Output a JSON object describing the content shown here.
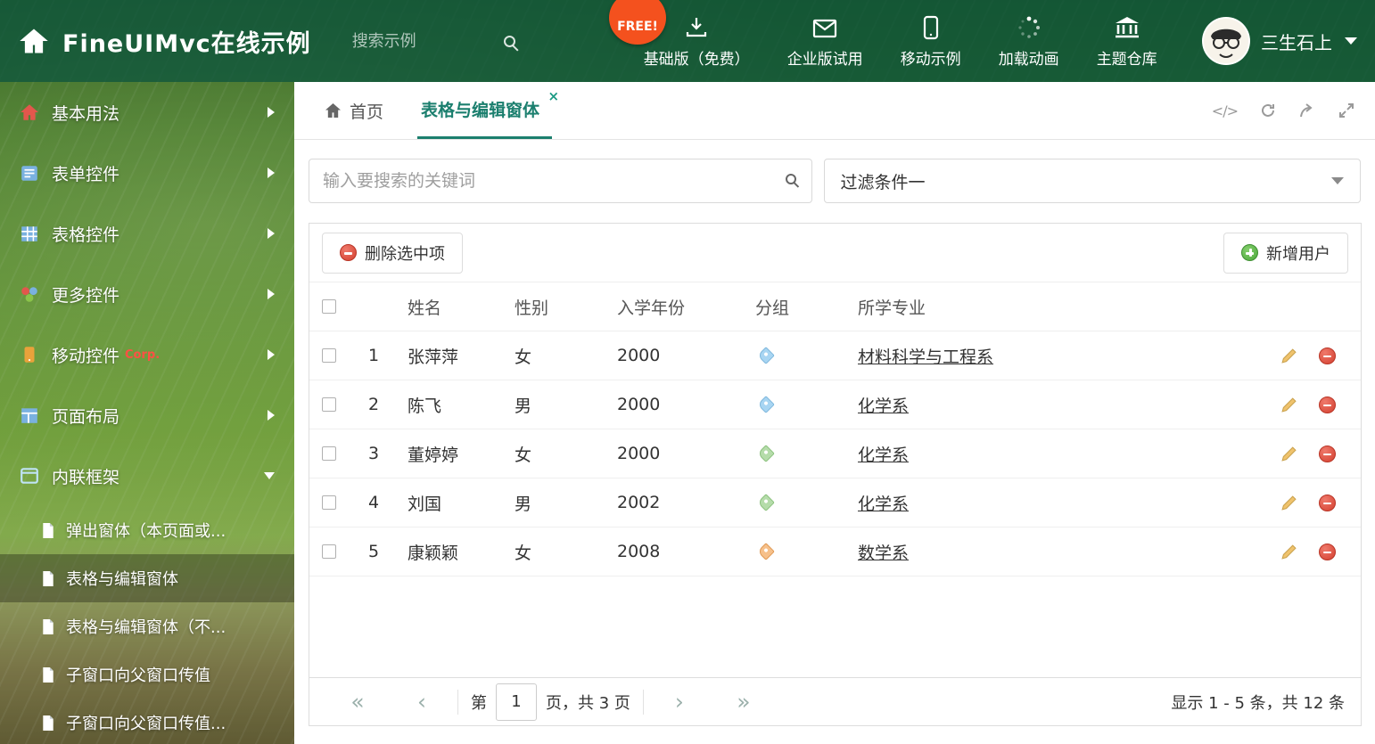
{
  "header": {
    "title": "FineUIMvc在线示例",
    "search_placeholder": "搜索示例",
    "free_badge": "FREE!",
    "nav": [
      {
        "label": "基础版（免费）",
        "icon": "download-icon"
      },
      {
        "label": "企业版试用",
        "icon": "envelope-icon"
      },
      {
        "label": "移动示例",
        "icon": "mobile-icon"
      },
      {
        "label": "加载动画",
        "icon": "spinner-icon"
      },
      {
        "label": "主题仓库",
        "icon": "bank-icon"
      }
    ],
    "user_name": "三生石上"
  },
  "sidebar": {
    "items": [
      {
        "label": "基本用法",
        "icon": "home-icon"
      },
      {
        "label": "表单控件",
        "icon": "form-icon"
      },
      {
        "label": "表格控件",
        "icon": "table-icon"
      },
      {
        "label": "更多控件",
        "icon": "widgets-icon"
      },
      {
        "label": "移动控件",
        "badge": "Corp.",
        "icon": "mobile-icon"
      },
      {
        "label": "页面布局",
        "icon": "layout-icon"
      },
      {
        "label": "内联框架",
        "icon": "frame-icon",
        "expanded": true
      }
    ],
    "subitems": [
      {
        "label": "弹出窗体（本页面或...",
        "active": false
      },
      {
        "label": "表格与编辑窗体",
        "active": true
      },
      {
        "label": "表格与编辑窗体（不...",
        "active": false
      },
      {
        "label": "子窗口向父窗口传值",
        "active": false
      },
      {
        "label": "子窗口向父窗口传值...",
        "active": false
      }
    ]
  },
  "tabs": {
    "home_label": "首页",
    "active_label": "表格与编辑窗体"
  },
  "filter": {
    "search_placeholder": "输入要搜索的关键词",
    "dropdown_value": "过滤条件一"
  },
  "toolbar": {
    "delete_label": "删除选中项",
    "add_label": "新增用户"
  },
  "table": {
    "columns": [
      "姓名",
      "性别",
      "入学年份",
      "分组",
      "所学专业"
    ],
    "rows": [
      {
        "num": "1",
        "name": "张萍萍",
        "gender": "女",
        "year": "2000",
        "tag_color": "blue",
        "major": "材料科学与工程系"
      },
      {
        "num": "2",
        "name": "陈飞",
        "gender": "男",
        "year": "2000",
        "tag_color": "blue",
        "major": "化学系"
      },
      {
        "num": "3",
        "name": "董婷婷",
        "gender": "女",
        "year": "2000",
        "tag_color": "green",
        "major": "化学系"
      },
      {
        "num": "4",
        "name": "刘国",
        "gender": "男",
        "year": "2002",
        "tag_color": "green",
        "major": "化学系"
      },
      {
        "num": "5",
        "name": "康颖颖",
        "gender": "女",
        "year": "2008",
        "tag_color": "orange",
        "major": "数学系"
      }
    ]
  },
  "pagination": {
    "prefix": "第",
    "page": "1",
    "suffix": "页，共 3 页",
    "summary": "显示 1 - 5 条，共 12 条"
  },
  "colors": {
    "accent": "#1b7f6e",
    "header_green": "#0f563c",
    "danger": "#d9534f",
    "success": "#5cb85c",
    "free_badge": "#f4511e",
    "tag_blue": "#a8d5f2",
    "tag_green": "#b5dcaa",
    "tag_orange": "#f6c08a"
  }
}
